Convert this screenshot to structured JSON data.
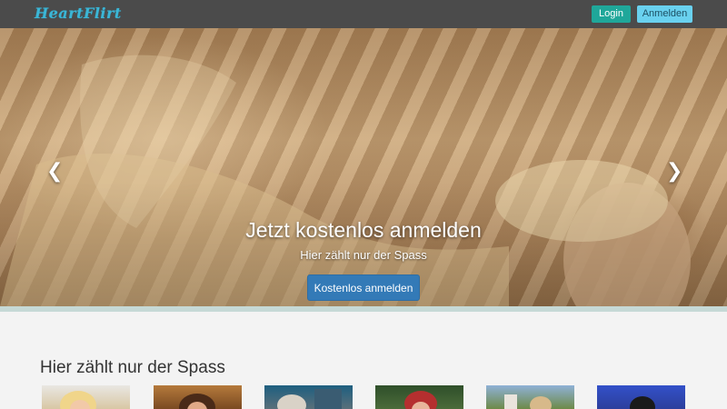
{
  "header": {
    "logo": "HeartFlirt",
    "login_label": "Login",
    "register_label": "Anmelden"
  },
  "hero": {
    "title": "Jetzt kostenlos anmelden",
    "subtitle": "Hier zählt nur der Spass",
    "cta_label": "Kostenlos anmelden",
    "prev_glyph": "❮",
    "next_glyph": "❯",
    "slides": 3,
    "active_slide": 1
  },
  "content": {
    "section_title": "Hier zählt nur der Spass"
  },
  "colors": {
    "header_bg": "#4b4b4b",
    "logo": "#3bb6d6",
    "login_btn": "#1fa79a",
    "register_btn": "#69d1ef",
    "cta_btn": "#337ab7"
  }
}
